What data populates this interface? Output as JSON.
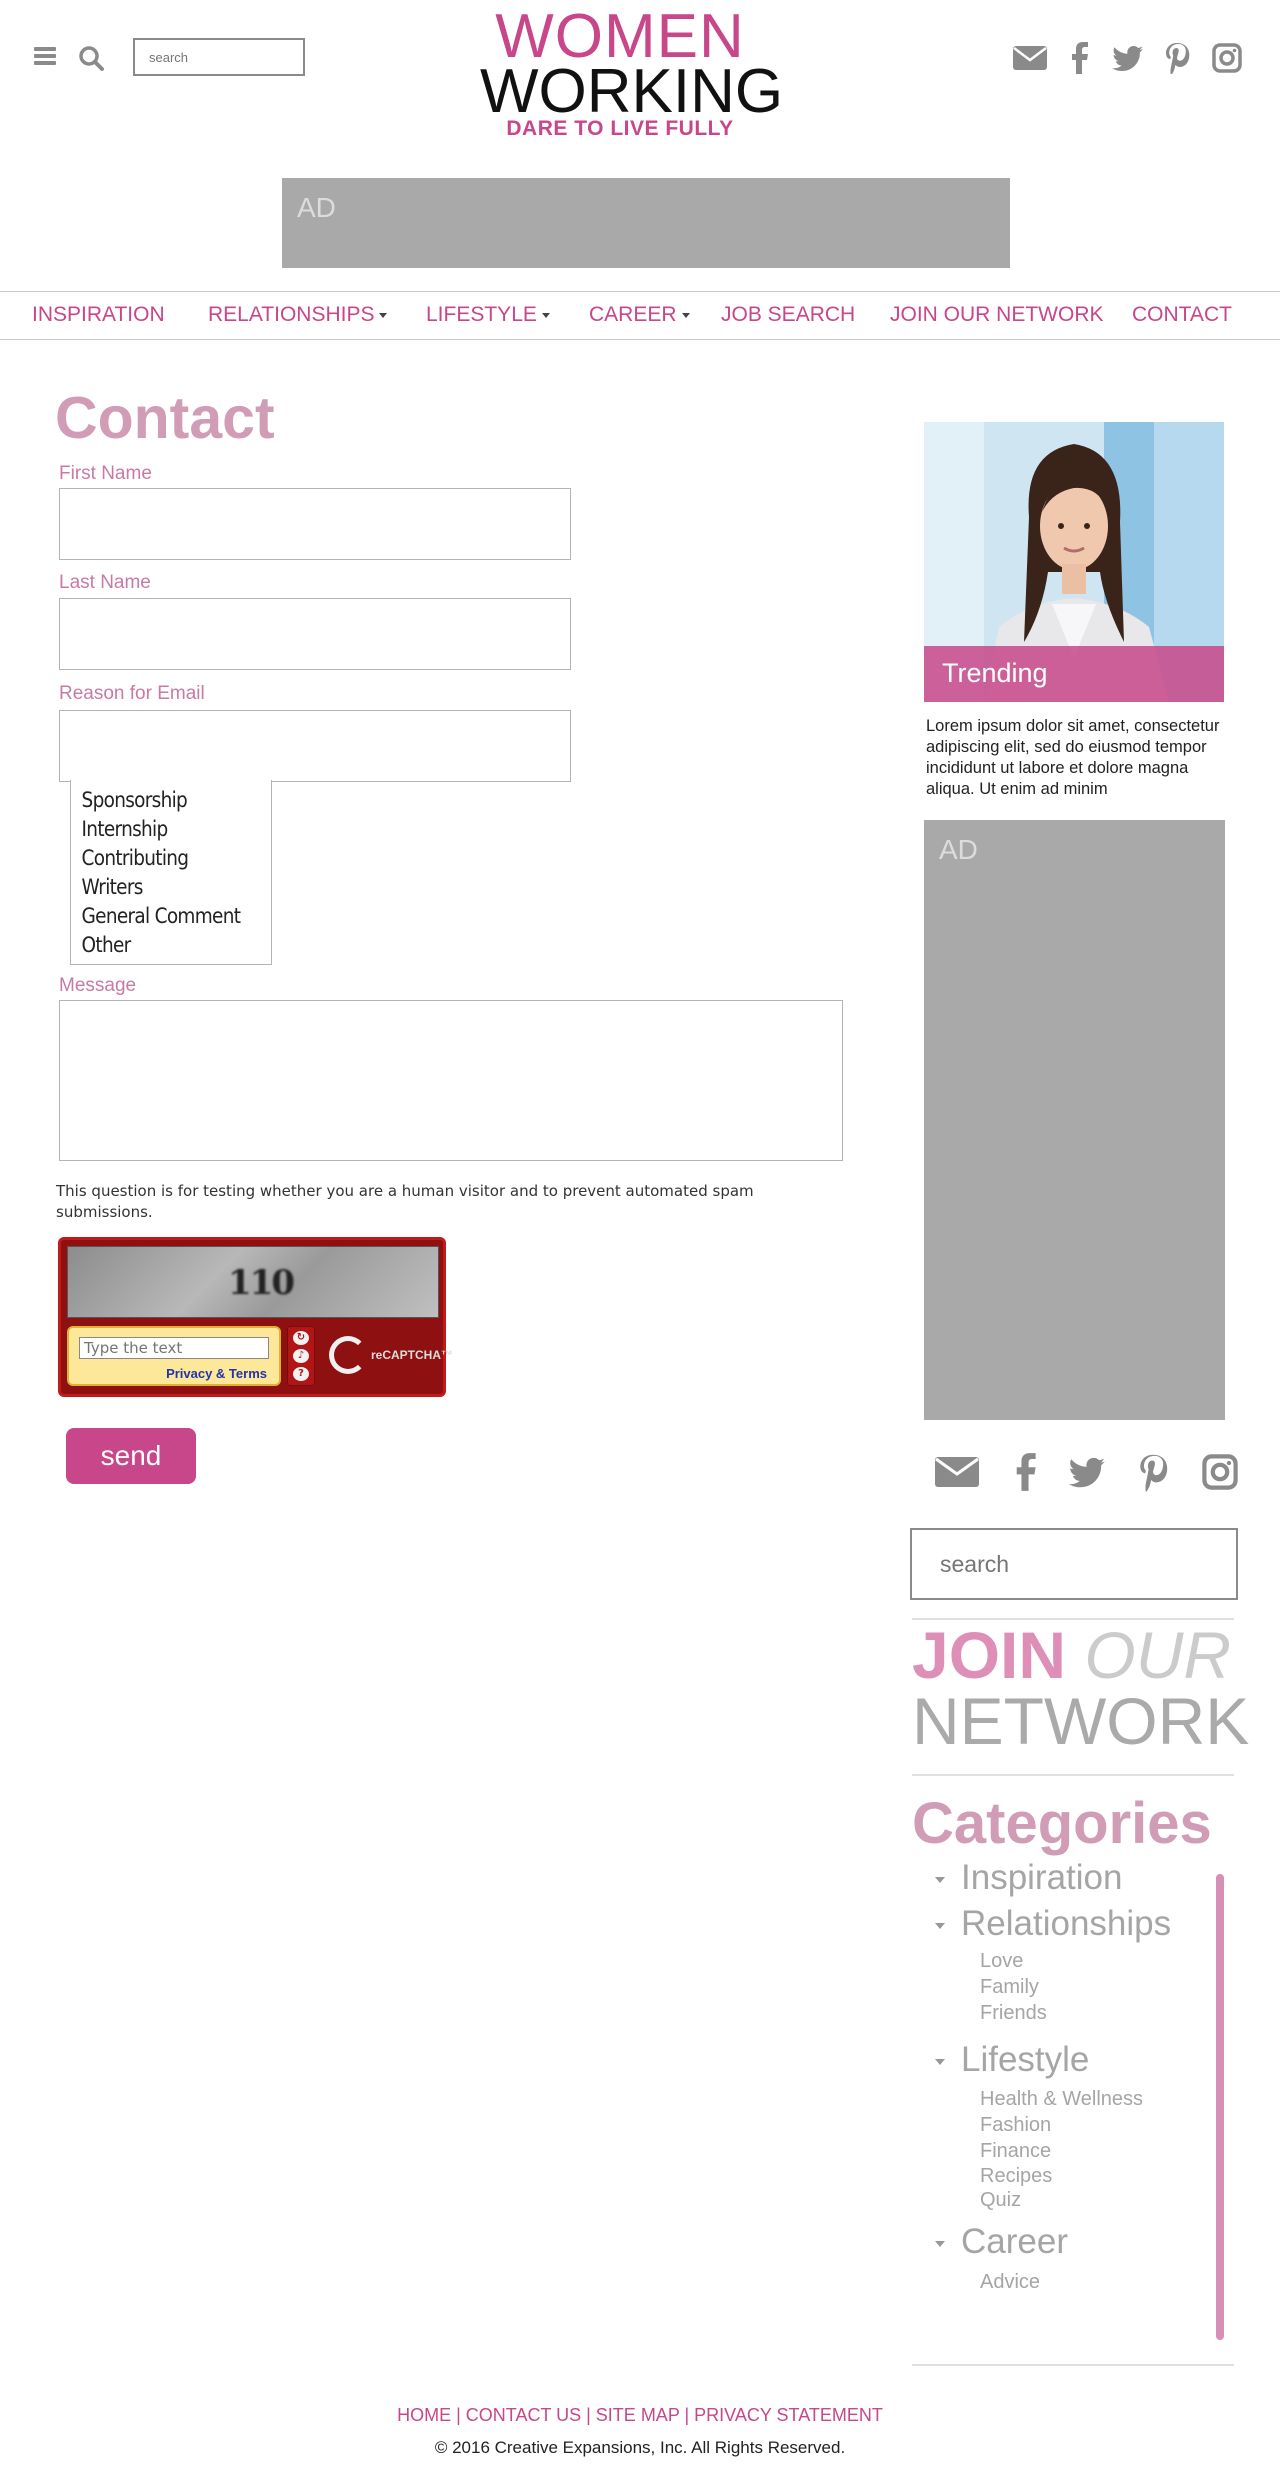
{
  "header": {
    "search_placeholder": "search",
    "logo_line1": "WOMEN",
    "logo_line2": "WORKING",
    "logo_tagline": "DARE TO LIVE FULLY",
    "ad_label": "AD"
  },
  "nav": {
    "items": [
      {
        "label": "INSPIRATION",
        "dropdown": false
      },
      {
        "label": "RELATIONSHIPS",
        "dropdown": true
      },
      {
        "label": "LIFESTYLE",
        "dropdown": true
      },
      {
        "label": "CAREER",
        "dropdown": true
      },
      {
        "label": "JOB SEARCH",
        "dropdown": false
      },
      {
        "label": "JOIN OUR NETWORK",
        "dropdown": false
      },
      {
        "label": "CONTACT",
        "dropdown": false
      }
    ]
  },
  "form": {
    "title": "Contact",
    "first_name_label": "First Name",
    "last_name_label": "Last Name",
    "reason_label": "Reason for Email",
    "reason_options": [
      "Sponsorship",
      "Internship",
      "Contributing Writers",
      "General Comment",
      "Other"
    ],
    "message_label": "Message",
    "captcha_note": "This question is for testing whether you are a human visitor and to prevent automated spam submissions.",
    "captcha_code": "110",
    "captcha_placeholder": "Type the text",
    "captcha_privacy": "Privacy & Terms",
    "captcha_brand": "reCAPTCHA™",
    "send_label": "send"
  },
  "sidebar": {
    "trending_label": "Trending",
    "trending_text": "Lorem ipsum dolor sit amet, consectetur adipiscing elit, sed do eiusmod tempor incididunt ut labore et dolore magna aliqua. Ut enim ad minim",
    "ad_label": "AD",
    "search_placeholder": "search",
    "join_word1": "JOIN",
    "join_word2": "OUR",
    "join_word3": "NETWORK",
    "categories_title": "Categories",
    "categories": [
      {
        "name": "Inspiration",
        "subs": []
      },
      {
        "name": "Relationships",
        "subs": [
          "Love",
          "Family",
          "Friends"
        ]
      },
      {
        "name": "Lifestyle",
        "subs": [
          "Health & Wellness",
          "Fashion",
          "Finance",
          "Recipes",
          "Quiz"
        ]
      },
      {
        "name": "Career",
        "subs": [
          "Advice"
        ]
      }
    ]
  },
  "footer": {
    "links": "HOME | CONTACT US | SITE MAP | PRIVACY STATEMENT",
    "copyright": "© 2016 Creative Expansions, Inc. All Rights Reserved."
  },
  "colors": {
    "brand_pink": "#c8468a",
    "muted_pink": "#d09cb6",
    "icon_gray": "#8a8a8a",
    "ad_gray": "#a9a9a9"
  },
  "icons": [
    "menu-icon",
    "search-icon",
    "email-icon",
    "facebook-icon",
    "twitter-icon",
    "pinterest-icon",
    "instagram-icon"
  ]
}
